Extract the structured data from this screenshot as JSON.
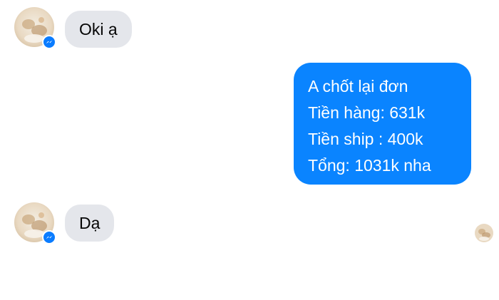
{
  "conversation": {
    "messages": [
      {
        "direction": "incoming",
        "text": "Oki ạ"
      },
      {
        "direction": "outgoing",
        "lines": [
          "A chốt lại đơn",
          "Tiền hàng: 631k",
          "Tiền ship : 400k",
          "Tổng: 1031k nha"
        ]
      },
      {
        "direction": "incoming",
        "text": "Dạ"
      }
    ]
  },
  "colors": {
    "outgoing_bubble": "#0A84FF",
    "incoming_bubble": "#E4E6EB",
    "messenger_badge": "#0A7CFF"
  },
  "icons": {
    "contact_avatar": "contact-avatar-icon",
    "messenger_badge": "messenger-badge-icon",
    "seen_indicator": "seen-avatar-icon"
  }
}
